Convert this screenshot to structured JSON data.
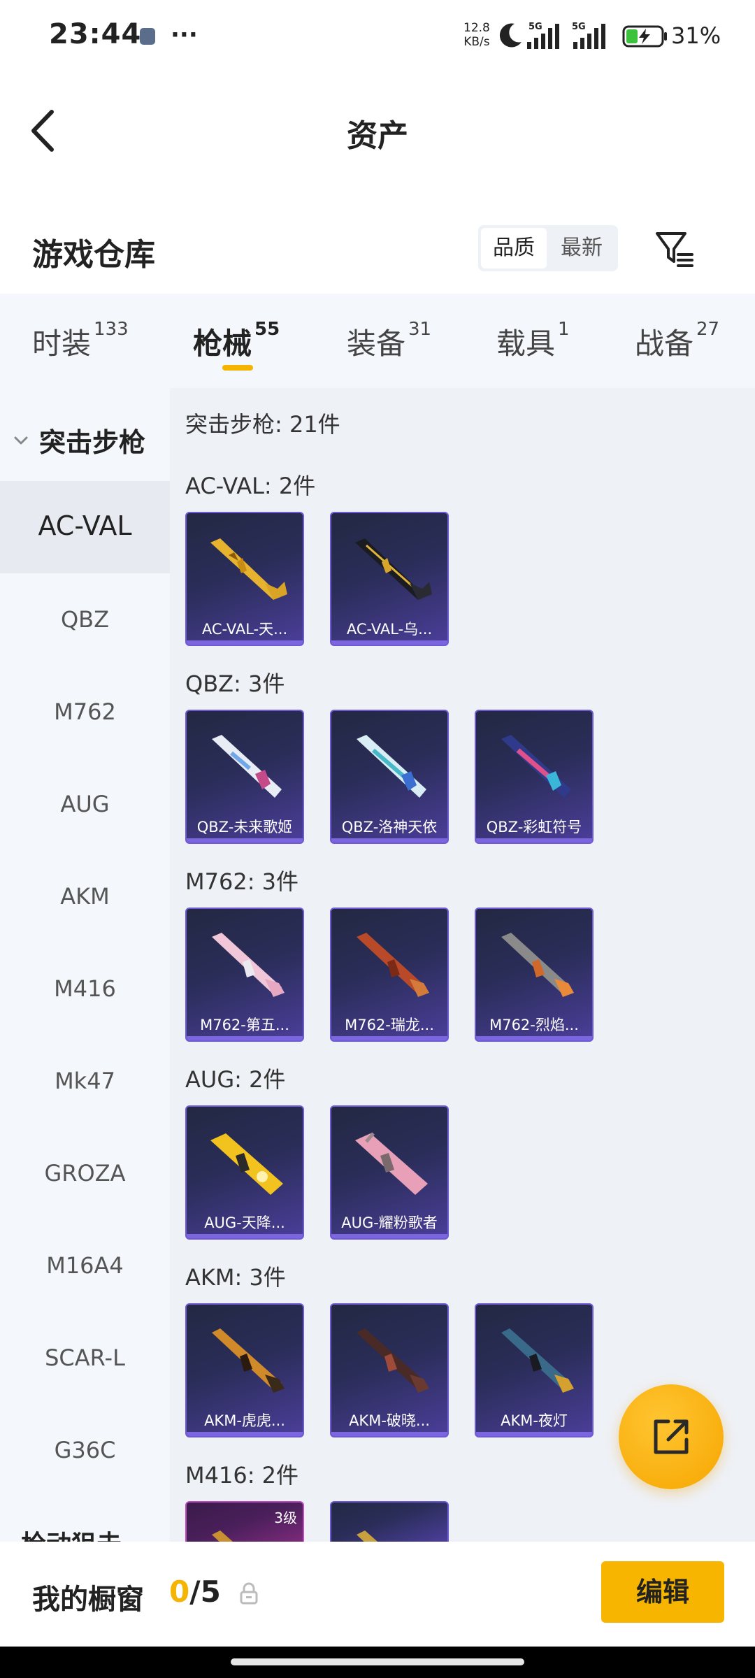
{
  "status_bar": {
    "time": "23:44",
    "more": "···",
    "net_speed_value": "12.8",
    "net_speed_unit": "KB/s",
    "signal_1_label": "5G",
    "signal_2_label": "5G",
    "battery_percent": "31%"
  },
  "header": {
    "title": "资产"
  },
  "warehouse": {
    "title": "游戏仓库",
    "sort_quality": "品质",
    "sort_newest": "最新"
  },
  "tabs": [
    {
      "label": "时装",
      "count": "133"
    },
    {
      "label": "枪械",
      "count": "55",
      "active": true
    },
    {
      "label": "装备",
      "count": "31"
    },
    {
      "label": "载具",
      "count": "1"
    },
    {
      "label": "战备",
      "count": "27"
    }
  ],
  "sidebar": {
    "group_label": "突击步枪",
    "items": [
      "AC-VAL",
      "QBZ",
      "M762",
      "AUG",
      "AKM",
      "M416",
      "Mk47",
      "GROZA",
      "M16A4",
      "SCAR-L",
      "G36C"
    ],
    "next_group_label": "枪动狙击"
  },
  "content": {
    "summary": "突击步枪: 21件",
    "sections": [
      {
        "title": "AC-VAL: 2件",
        "cards": [
          "AC-VAL-天...",
          "AC-VAL-乌..."
        ]
      },
      {
        "title": "QBZ: 3件",
        "cards": [
          "QBZ-未来歌姬",
          "QBZ-洛神天依",
          "QBZ-彩虹符号"
        ]
      },
      {
        "title": "M762: 3件",
        "cards": [
          "M762-第五...",
          "M762-瑞龙...",
          "M762-烈焰..."
        ]
      },
      {
        "title": "AUG: 2件",
        "cards": [
          "AUG-天降...",
          "AUG-耀粉歌者"
        ]
      },
      {
        "title": "AKM: 3件",
        "cards": [
          "AKM-虎虎...",
          "AKM-破晓...",
          "AKM-夜灯"
        ]
      },
      {
        "title": "M416: 2件",
        "level_badge": "3级"
      }
    ]
  },
  "bottom_bar": {
    "showcase_label": "我的橱窗",
    "showcase_current": "0",
    "showcase_total": "/5",
    "edit_label": "编辑"
  },
  "colors": {
    "accent": "#f5b400",
    "card_border": "#6f5ad6",
    "tier3_border": "#c04bc0"
  }
}
